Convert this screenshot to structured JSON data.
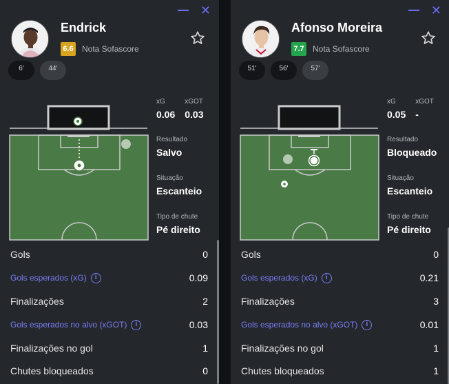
{
  "rating_label": "Nota Sofascore",
  "labels": {
    "xg": "xG",
    "xgot": "xGOT",
    "result": "Resultado",
    "situation": "Situação",
    "shot_type": "Tipo de chute"
  },
  "colors": {
    "panel_bg": "#24272b",
    "accent": "#6b6ef6",
    "pitch": "#4a7a45",
    "rating_yellow": "#d9a320",
    "rating_green": "#25a54b"
  },
  "left": {
    "name": "Endrick",
    "rating": "6.6",
    "rating_color": "#d9a320",
    "chips": [
      "6'",
      "44'"
    ],
    "xg": "0.06",
    "xgot": "0.03",
    "result": "Salvo",
    "situation": "Escanteio",
    "shot_type": "Pé direito",
    "stats": [
      {
        "label": "Gols",
        "value": "0"
      },
      {
        "label": "Gols esperados (xG)",
        "value": "0.09"
      },
      {
        "label": "Finalizações",
        "value": "2"
      },
      {
        "label": "Gols esperados no alvo (xGOT)",
        "value": "0.03"
      },
      {
        "label": "Finalizações no gol",
        "value": "1"
      },
      {
        "label": "Chutes bloqueados",
        "value": "0"
      }
    ]
  },
  "right": {
    "name": "Afonso Moreira",
    "rating": "7.7",
    "rating_color": "#25a54b",
    "chips": [
      "51'",
      "56'",
      "57'"
    ],
    "xg": "0.05",
    "xgot": "-",
    "result": "Bloqueado",
    "situation": "Escanteio",
    "shot_type": "Pé direito",
    "stats": [
      {
        "label": "Gols",
        "value": "0"
      },
      {
        "label": "Gols esperados (xG)",
        "value": "0.21"
      },
      {
        "label": "Finalizações",
        "value": "3"
      },
      {
        "label": "Gols esperados no alvo (xGOT)",
        "value": "0.01"
      },
      {
        "label": "Finalizações no gol",
        "value": "1"
      },
      {
        "label": "Chutes bloqueados",
        "value": "1"
      }
    ]
  }
}
